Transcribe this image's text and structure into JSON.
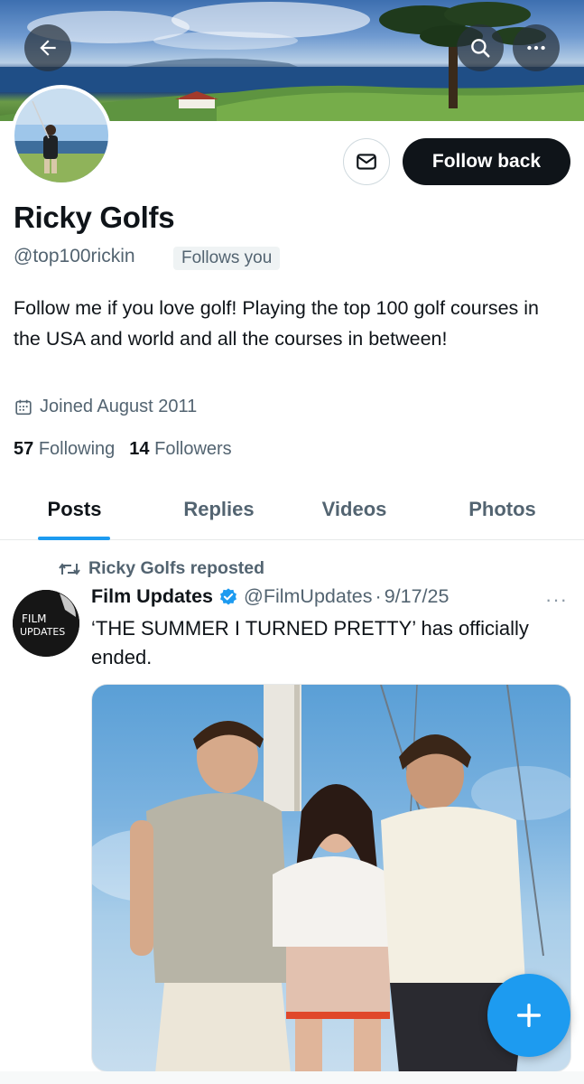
{
  "header": {
    "back_icon": "arrow-left-icon",
    "search_icon": "search-icon",
    "more_icon": "more-horizontal-icon"
  },
  "profile": {
    "display_name": "Ricky Golfs",
    "handle": "@top100rickin",
    "follows_you_badge": "Follows you",
    "bio": "Follow me if you love golf! Playing the top 100 golf courses in the USA and world and all the courses in between!",
    "joined": "Joined August 2011",
    "following_count": "57",
    "following_label": "Following",
    "followers_count": "14",
    "followers_label": "Followers"
  },
  "actions": {
    "message_icon": "envelope-icon",
    "follow_back_label": "Follow back"
  },
  "tabs": [
    {
      "label": "Posts",
      "active": true
    },
    {
      "label": "Replies",
      "active": false
    },
    {
      "label": "Videos",
      "active": false
    },
    {
      "label": "Photos",
      "active": false
    }
  ],
  "post": {
    "repost_label": "Ricky Golfs reposted",
    "author_name": "Film Updates",
    "author_handle": "@FilmUpdates",
    "separator": "·",
    "date": "9/17/25",
    "more_label": "···",
    "text": "‘THE SUMMER I TURNED PRETTY’ has officially ended.",
    "avatar_text_line1": "FILM",
    "avatar_text_line2": "UPDATES"
  },
  "fab": {
    "icon": "plus-icon"
  },
  "colors": {
    "accent": "#1d9bf0",
    "text_primary": "#0f1419",
    "text_secondary": "#536471",
    "follow_button_bg": "#0f1419"
  }
}
